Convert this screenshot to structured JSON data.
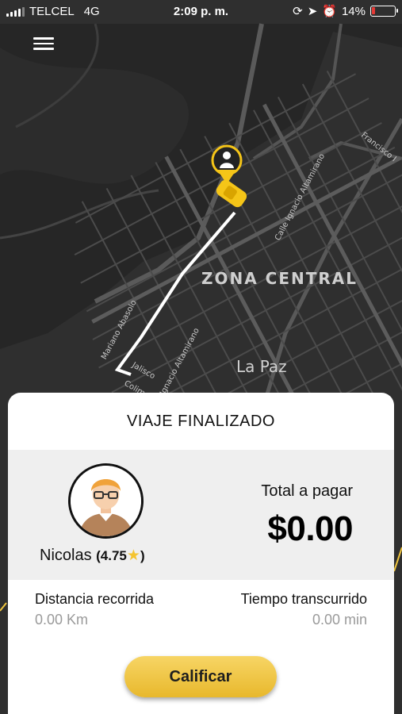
{
  "status_bar": {
    "carrier": "TELCEL",
    "network": "4G",
    "time": "2:09 p. m.",
    "battery_percent": "14%",
    "battery_color": "#e53935"
  },
  "map": {
    "labels": {
      "zona_central": "ZONA CENTRAL",
      "la_paz": "La Paz",
      "calle_altamirano": "Calle Ignacio Altamirano",
      "francisco": "Francisco I",
      "mariano_abasolo": "Mariano Abasolo",
      "jalisco": "Jalisco",
      "colima": "Colima",
      "ignacio_altamirano": "Ignacio Altamirano"
    },
    "route_color": "#ffffff",
    "marker_color": "#f5c518"
  },
  "trip_summary": {
    "title": "VIAJE FINALIZADO",
    "driver": {
      "name": "Nicolas",
      "rating": "(4.75",
      "rating_close": ")"
    },
    "total_label": "Total a pagar",
    "total_amount": "$0.00",
    "distance_label": "Distancia recorrida",
    "distance_value": "0.00 Km",
    "time_label": "Tiempo transcurrido",
    "time_value": "0.00 min",
    "rate_button": "Calificar",
    "accent_color": "#f0c53e"
  }
}
